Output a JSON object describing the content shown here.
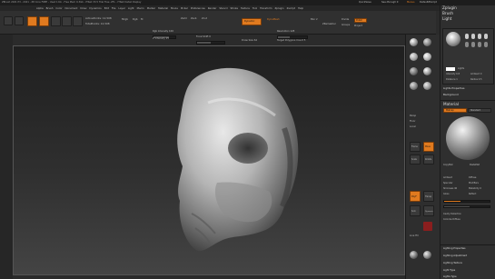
{
  "titlebar": {
    "title": "ZBrush 2021 P3 - 2021 - Z8 Core FREE - Used 1mb - Free Mem 9.3Gb - HTest 33.5 Trial Free .ZTL - HTest Detail Display",
    "right_items": [
      "QuickSave",
      "See-through 0",
      "Menus",
      "DefaultZScript"
    ]
  },
  "menubar": {
    "items": [
      "Alpha",
      "Brush",
      "Color",
      "Document",
      "Draw",
      "Dynamics",
      "Edit",
      "File",
      "Layer",
      "Light",
      "Macro",
      "Marker",
      "Material",
      "Movie",
      "Picker",
      "Preferences",
      "Render",
      "Stencil",
      "Stroke",
      "Texture",
      "Tool",
      "Transform",
      "Zplugin",
      "Zscript",
      "Help"
    ]
  },
  "top_shelf": {
    "mode_icons": [
      "Home",
      "LightBox",
      "Edit",
      "Draw",
      "Move",
      "Scale",
      "Rotate"
    ],
    "mrgb_label": "Mrgb",
    "rgb_label": "Rgb",
    "m_label": "M",
    "zadd_label": "Zadd",
    "zsub_label": "Zsub",
    "zcut_label": "Zcut",
    "focal_shift": "Focal Shift 0",
    "draw_size": "Draw Size 64",
    "z_intensity": "Z Intensity 25",
    "rgb_intensity": "Rgb Intensity 100",
    "dynamic_label": "Dynamic",
    "active_points": "ActivePoints: 12,508",
    "total_points": "TotalPoints: 12,508",
    "polyframe": "PolyF",
    "solo": "Solo",
    "transp": "Transp",
    "dynamesh": "DynaMesh",
    "resolution": "Resolution 128",
    "divide": "Divide",
    "groups": "Groups",
    "polish": "Polish",
    "project": "Project",
    "blur": "Blur 2",
    "target_polygons": "Target Polygons Count 5",
    "zremesher": "ZRemesher"
  },
  "left_panel": {
    "brush_labels": [
      "Brush",
      "Stroke",
      "Alpha",
      "Texture",
      "Material",
      "Color"
    ]
  },
  "right_toolbar": {
    "tool_labels": [
      "Persp",
      "Floor",
      "Local",
      "Frame",
      "Move",
      "Scale",
      "Rotate",
      "PolyF",
      "Transp",
      "Solo",
      "Dynamic",
      "Line Fill"
    ],
    "extra_labels": [
      "BPR",
      "SPix 3",
      "Scroll",
      "Zoom",
      "Actual",
      "AAHalf"
    ]
  },
  "right_palette_top": {
    "tabs": [
      "Zplugin",
      "Brush",
      "Light"
    ],
    "light_sub_labels": [
      "Lights",
      "Intensity 0.8",
      "Ambient 0",
      "Distance 1",
      "Radius 0.5",
      "Sh Angle 5"
    ],
    "lights_properties": "Lights Properties",
    "background": "Background"
  },
  "right_palette_bottom": {
    "header": "Material",
    "tabs": [
      "Matcap",
      "Standard"
    ],
    "labels": [
      "Ambient",
      "Diffuse",
      "Specular",
      "Modifiers",
      "Shininess 40",
      "Metalicity 0",
      "Gloss",
      "Reflect",
      "Cavity Detection",
      "Colorize Diffuse",
      "Lighting Properties",
      "Lighting Adjustment",
      "Lighting Texture",
      "Light Type",
      "Lights Type"
    ],
    "copy_paste": [
      "CopyMat",
      "PasteMat"
    ]
  },
  "canvas": {
    "subject": "sculpted-skull"
  },
  "colors": {
    "accent": "#e07a1f",
    "background": "#2b2b2b",
    "canvas_top": "#1e1e1e",
    "canvas_bottom": "#404040"
  }
}
